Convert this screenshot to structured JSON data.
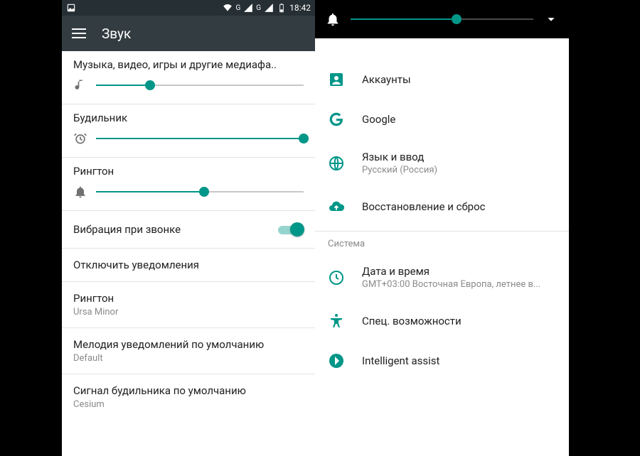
{
  "statusbar": {
    "time": "18:42",
    "g_label": "G"
  },
  "appbar": {
    "title": "Звук"
  },
  "sliders": {
    "media": {
      "label": "Музыка, видео, игры и другие медиафа..",
      "percent": 26
    },
    "alarm": {
      "label": "Будильник",
      "percent": 100
    },
    "ring": {
      "label": "Рингтон",
      "percent": 52
    }
  },
  "toggle": {
    "label": "Вибрация при звонке",
    "on": true
  },
  "items_left": {
    "disable_notif": "Отключить уведомления",
    "ringtone": {
      "title": "Рингтон",
      "value": "Ursa Minor"
    },
    "notif_default": {
      "title": "Мелодия уведомлений по умолчанию",
      "value": "Default"
    },
    "alarm_default": {
      "title": "Сигнал будильника по умолчанию",
      "value": "Cesium"
    }
  },
  "volume_overlay": {
    "percent": 58
  },
  "settings": {
    "accounts": "Аккаунты",
    "google": "Google",
    "lang": {
      "title": "Язык и ввод",
      "sub": "Русский (Россия)"
    },
    "backup": "Восстановление и сброс",
    "section": "Система",
    "datetime": {
      "title": "Дата и время",
      "sub": "GMT+03:00 Восточная Европа, летнее в..."
    },
    "accessibility": "Спец. возможности",
    "assist": "Intelligent assist"
  }
}
